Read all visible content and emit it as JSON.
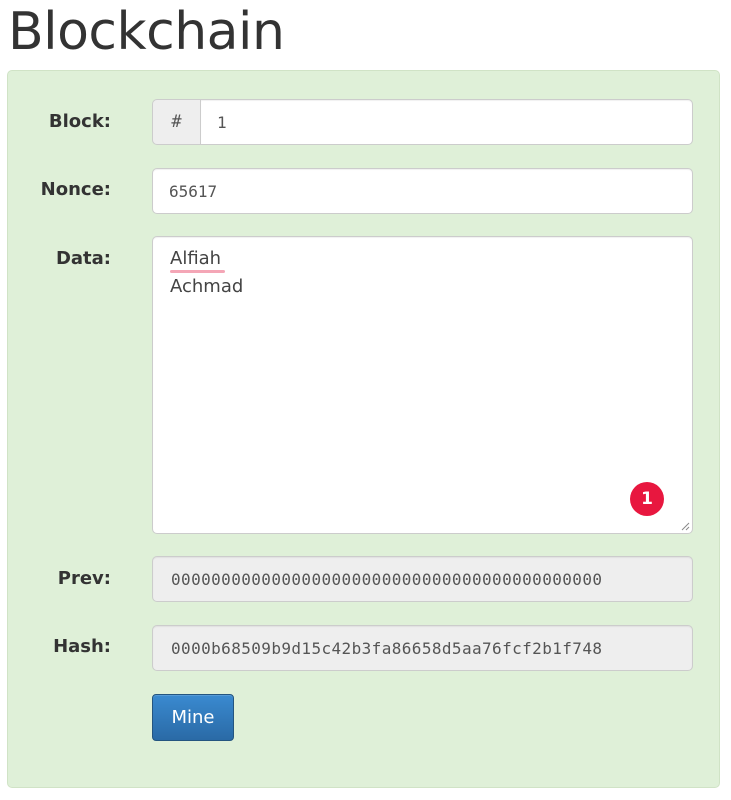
{
  "page": {
    "title": "Blockchain"
  },
  "block": {
    "label": "Block:",
    "prefix": "#",
    "value": "1"
  },
  "nonce": {
    "label": "Nonce:",
    "value": "65617"
  },
  "data_field": {
    "label": "Data:",
    "lines": [
      "Alfiah",
      "Achmad"
    ],
    "badge_count": "1"
  },
  "prev": {
    "label": "Prev:",
    "value": "0000000000000000000000000000000000000000000"
  },
  "hash": {
    "label": "Hash:",
    "value": "0000b68509b9d15c42b3fa86658d5aa76fcf2b1f748"
  },
  "actions": {
    "mine_label": "Mine"
  },
  "colors": {
    "card_background": "#dff0d8",
    "mine_button": "#2a6aa6",
    "badge": "#e8173f",
    "spellcheck_underline": "#f4a6b6"
  }
}
